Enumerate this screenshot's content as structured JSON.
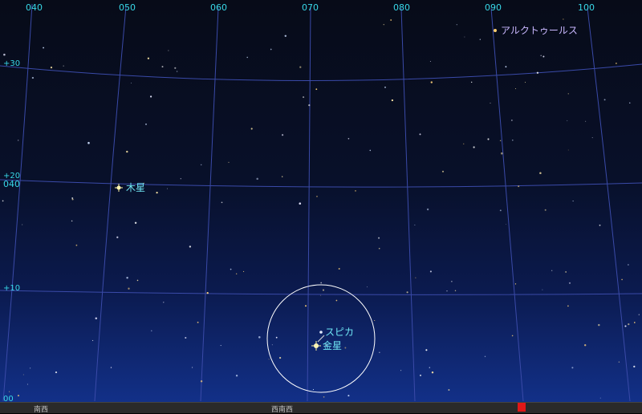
{
  "ra_labels": [
    "040",
    "050",
    "060",
    "070",
    "080",
    "090",
    "100"
  ],
  "dec_labels": [
    "+30",
    "+20",
    "+10",
    "00"
  ],
  "az_label": "040",
  "objects": {
    "arcturus": "アルクトゥールス",
    "jupiter": "木星",
    "spica": "スピカ",
    "venus": "金星"
  },
  "directions": [
    "南西",
    "西南西"
  ],
  "colors": {
    "grid": "#3a4aa8",
    "label": "#38d8e8",
    "circle": "#ffffff",
    "marker": "#e01818"
  }
}
